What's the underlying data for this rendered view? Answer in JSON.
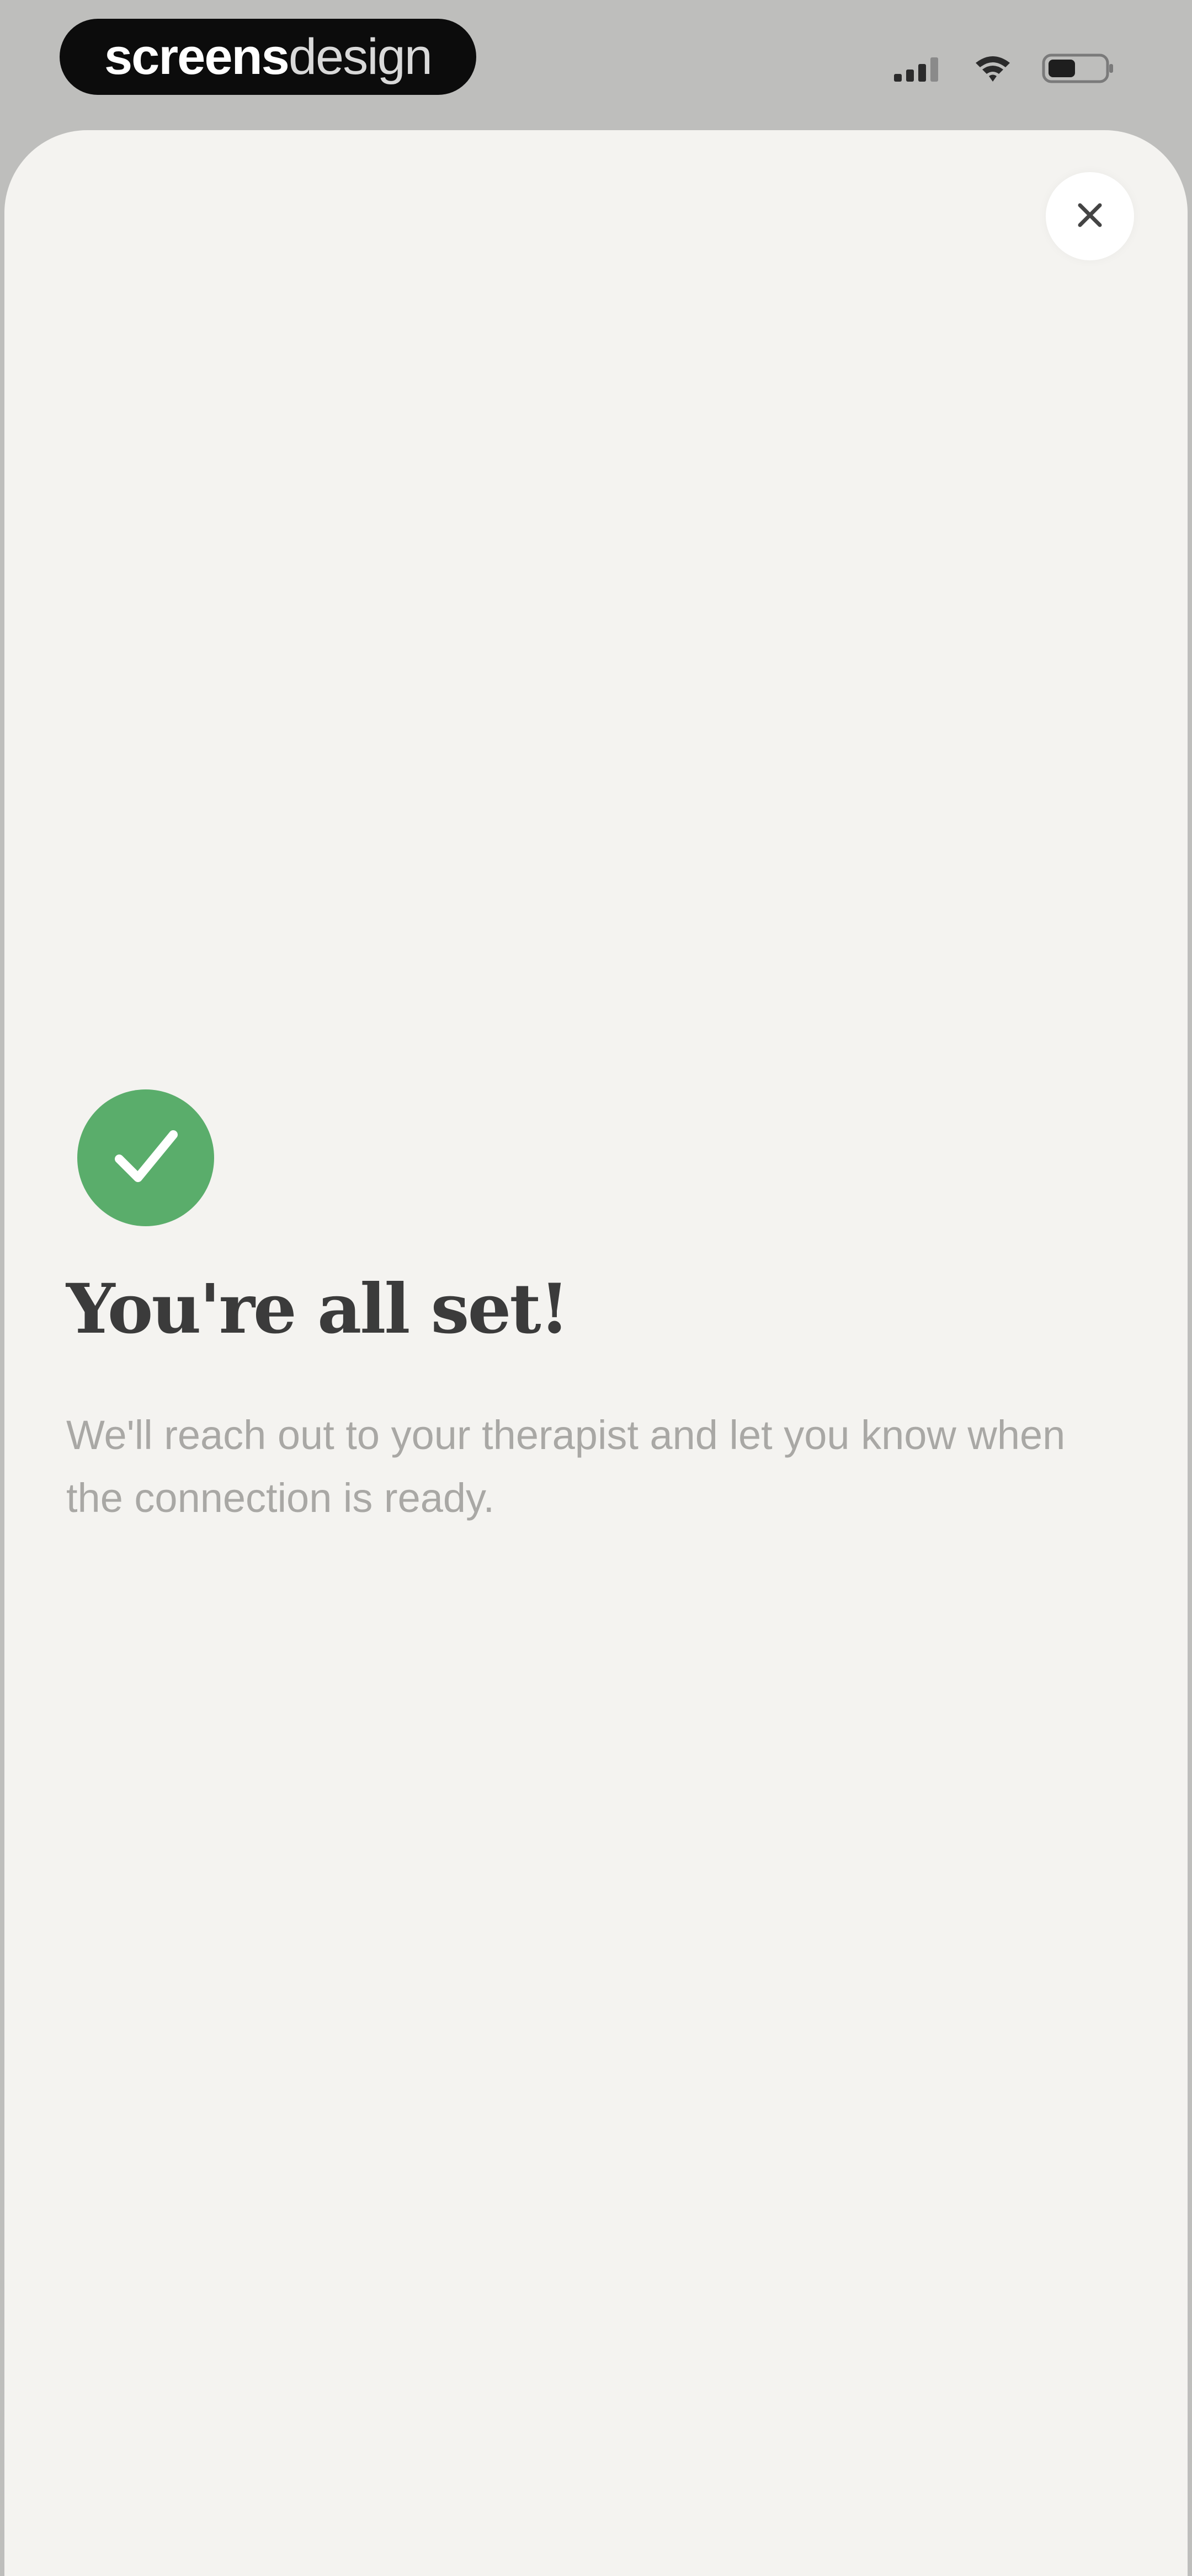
{
  "status_bar": {
    "watermark_bold": "screens",
    "watermark_light": "design"
  },
  "icons": {
    "signal": "cellular-signal-icon",
    "wifi": "wifi-icon",
    "battery": "battery-icon",
    "close": "close-icon",
    "check": "checkmark-icon"
  },
  "colors": {
    "accent_success": "#5aad6b",
    "sheet_background": "#f4f3f0",
    "title_text": "#3b3b3b",
    "body_text": "#a9a8a5"
  },
  "confirmation": {
    "title": "You're all set!",
    "message": "We'll reach out to your therapist and let you know when the connection is ready."
  }
}
